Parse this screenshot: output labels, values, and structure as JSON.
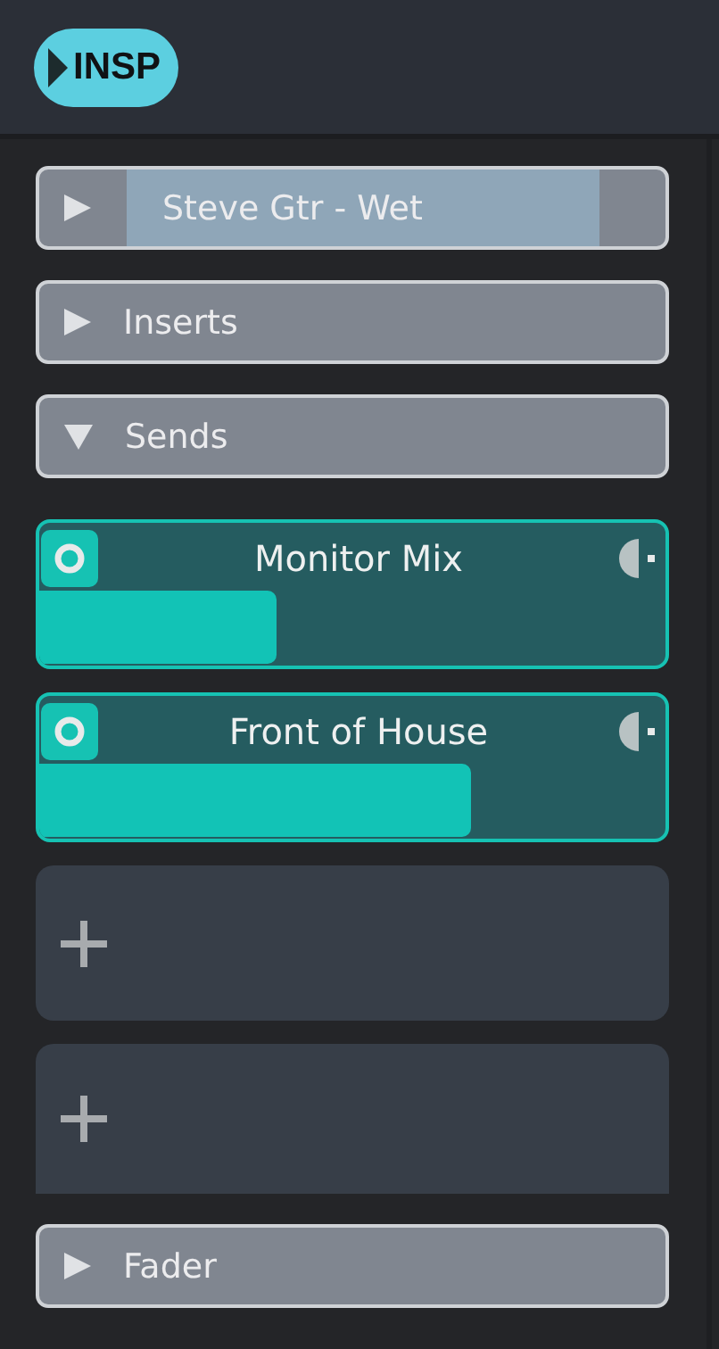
{
  "header": {
    "button": {
      "label": "INSP",
      "expanded": false
    }
  },
  "sections": [
    {
      "kind": "track",
      "label": "Steve Gtr - Wet",
      "expanded": false
    },
    {
      "kind": "group",
      "label": "Inserts",
      "expanded": false
    },
    {
      "kind": "group",
      "label": "Sends",
      "expanded": true,
      "slots": [
        {
          "kind": "send",
          "name": "Monitor Mix",
          "level": 0.38
        },
        {
          "kind": "send",
          "name": "Front of House",
          "level": 0.69
        },
        {
          "kind": "empty"
        },
        {
          "kind": "empty"
        }
      ]
    },
    {
      "kind": "group",
      "label": "Fader",
      "expanded": false
    }
  ]
}
